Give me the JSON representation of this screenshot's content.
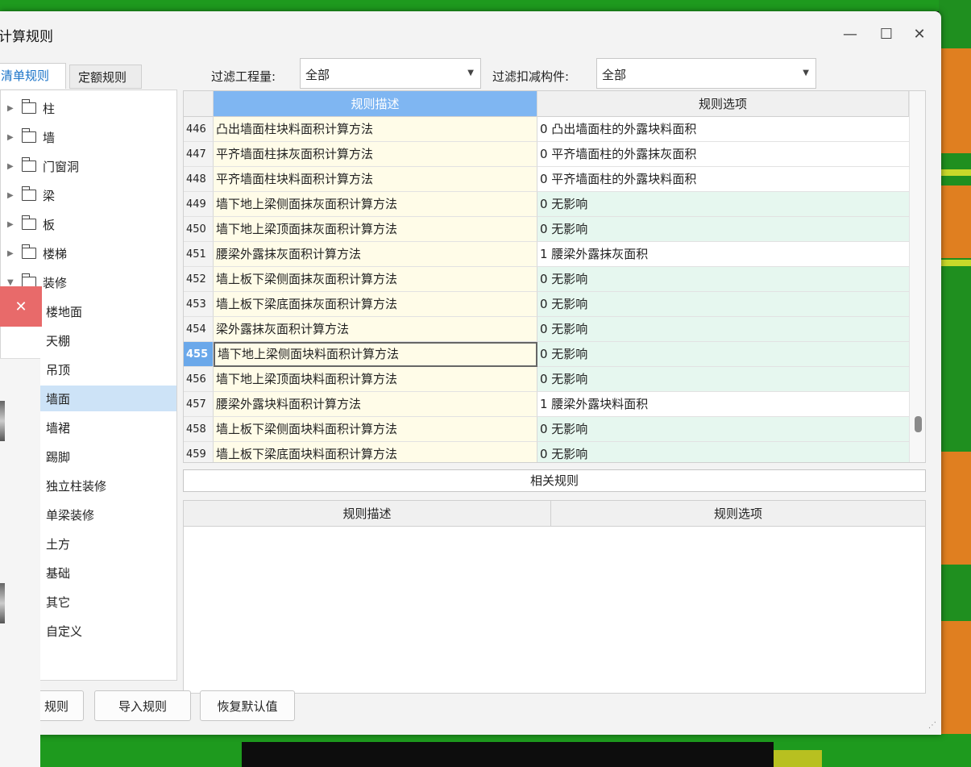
{
  "window": {
    "title": "计算规则"
  },
  "controls": {
    "minimize": "—",
    "maximize": "☐",
    "close": "✕"
  },
  "tabs": [
    {
      "label": "清单规则"
    },
    {
      "label": "定额规则"
    }
  ],
  "filters": {
    "quantity_label": "过滤工程量:",
    "quantity_value": "全部",
    "deduct_label": "过滤扣减构件:",
    "deduct_value": "全部"
  },
  "tree": {
    "folders": [
      {
        "label": "柱"
      },
      {
        "label": "墙"
      },
      {
        "label": "门窗洞"
      },
      {
        "label": "梁"
      },
      {
        "label": "板"
      },
      {
        "label": "楼梯"
      },
      {
        "label": "装修"
      }
    ],
    "children": [
      {
        "label": "楼地面"
      },
      {
        "label": "天棚"
      },
      {
        "label": "吊顶"
      },
      {
        "label": "墙面"
      },
      {
        "label": "墙裙"
      },
      {
        "label": "踢脚"
      },
      {
        "label": "独立柱装修"
      },
      {
        "label": "单梁装修"
      },
      {
        "label": "土方"
      },
      {
        "label": "基础"
      },
      {
        "label": "其它"
      },
      {
        "label": "自定义"
      }
    ]
  },
  "grid": {
    "header_desc": "规则描述",
    "header_opt": "规则选项",
    "rows": [
      {
        "num": "446",
        "desc": "凸出墙面柱块料面积计算方法",
        "opt": "0 凸出墙面柱的外露块料面积"
      },
      {
        "num": "447",
        "desc": "平齐墙面柱抹灰面积计算方法",
        "opt": "0 平齐墙面柱的外露抹灰面积"
      },
      {
        "num": "448",
        "desc": "平齐墙面柱块料面积计算方法",
        "opt": "0 平齐墙面柱的外露块料面积"
      },
      {
        "num": "449",
        "desc": "墙下地上梁侧面抹灰面积计算方法",
        "opt": "0  无影响"
      },
      {
        "num": "450",
        "desc": "墙下地上梁顶面抹灰面积计算方法",
        "opt": "0  无影响"
      },
      {
        "num": "451",
        "desc": "腰梁外露抹灰面积计算方法",
        "opt": "1 腰梁外露抹灰面积"
      },
      {
        "num": "452",
        "desc": "墙上板下梁侧面抹灰面积计算方法",
        "opt": "0  无影响"
      },
      {
        "num": "453",
        "desc": "墙上板下梁底面抹灰面积计算方法",
        "opt": "0  无影响"
      },
      {
        "num": "454",
        "desc": "梁外露抹灰面积计算方法",
        "opt": "0  无影响"
      },
      {
        "num": "455",
        "desc": "墙下地上梁侧面块料面积计算方法",
        "opt": "0  无影响"
      },
      {
        "num": "456",
        "desc": "墙下地上梁顶面块料面积计算方法",
        "opt": "0  无影响"
      },
      {
        "num": "457",
        "desc": "腰梁外露块料面积计算方法",
        "opt": "1 腰梁外露块料面积"
      },
      {
        "num": "458",
        "desc": "墙上板下梁侧面块料面积计算方法",
        "opt": "0  无影响"
      },
      {
        "num": "459",
        "desc": "墙上板下梁底面块料面积计算方法",
        "opt": "0  无影响"
      }
    ]
  },
  "related": {
    "label": "相关规则",
    "header_desc": "规则描述",
    "header_opt": "规则选项"
  },
  "buttons": {
    "export": "规则",
    "import": "导入规则",
    "restore": "恢复默认值"
  }
}
